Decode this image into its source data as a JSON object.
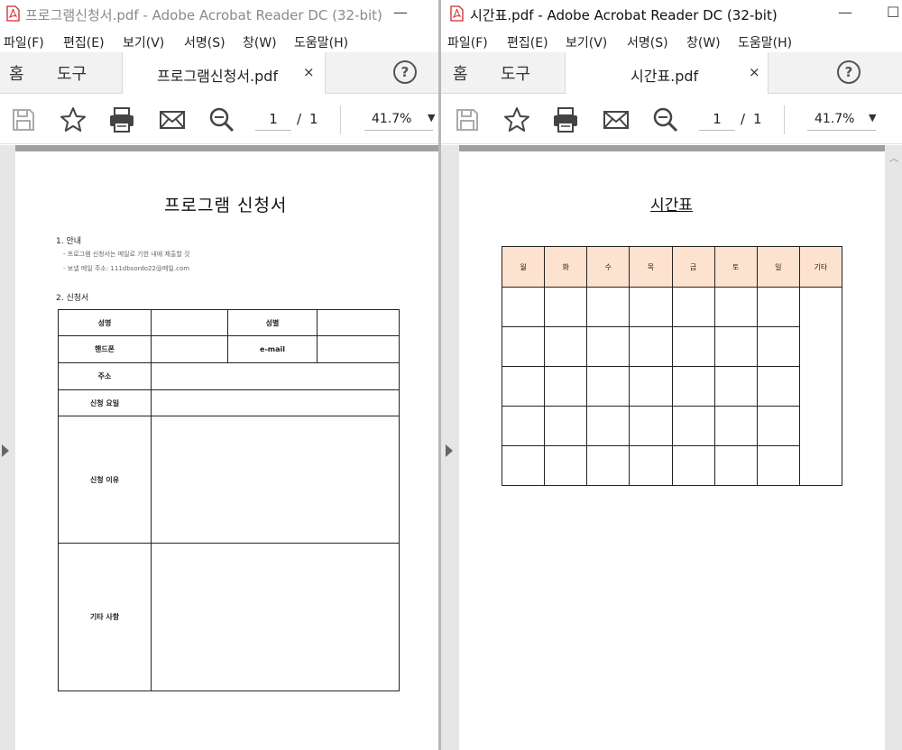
{
  "left": {
    "title": "프로그램신청서.pdf - Adobe Acrobat Reader DC (32-bit)",
    "minimize": "—",
    "menu": [
      "파일(F)",
      "편집(E)",
      "보기(V)",
      "서명(S)",
      "창(W)",
      "도움말(H)"
    ],
    "tabs": {
      "home": "홈",
      "tools": "도구",
      "doc": "프로그램신청서.pdf",
      "close": "×",
      "help": "?"
    },
    "toolbar": {
      "page": "1",
      "sep": "/",
      "total": "1",
      "zoom": "41.7%",
      "caret": "▼"
    },
    "doc": {
      "title": "프로그램 신청서",
      "section1": "1. 안내",
      "note1": "- 프로그램 신청서는 메일로 기한 내에 제출할 것",
      "note2": "- 보낼 메일 주소: 111dbsordo22@메일.com",
      "section2": "2. 신청서",
      "form": {
        "name": "성명",
        "gender": "성별",
        "phone": "핸드폰",
        "email": "e-mail",
        "address": "주소",
        "day": "신청 요일",
        "reason": "신청 이유",
        "etc": "기타 사항"
      }
    }
  },
  "right": {
    "title": "시간표.pdf - Adobe Acrobat Reader DC (32-bit)",
    "minimize": "—",
    "maximize": "☐",
    "menu": [
      "파일(F)",
      "편집(E)",
      "보기(V)",
      "서명(S)",
      "창(W)",
      "도움말(H)"
    ],
    "tabs": {
      "home": "홈",
      "tools": "도구",
      "doc": "시간표.pdf",
      "close": "×",
      "help": "?"
    },
    "toolbar": {
      "page": "1",
      "sep": "/",
      "total": "1",
      "zoom": "41.7%",
      "caret": "▼"
    },
    "doc": {
      "title": "시간표",
      "days": [
        "월",
        "화",
        "수",
        "목",
        "금",
        "토",
        "일",
        "기타"
      ]
    }
  },
  "colors": {
    "header_fill": "#fde3cf",
    "pdf_red": "#d4272b"
  }
}
